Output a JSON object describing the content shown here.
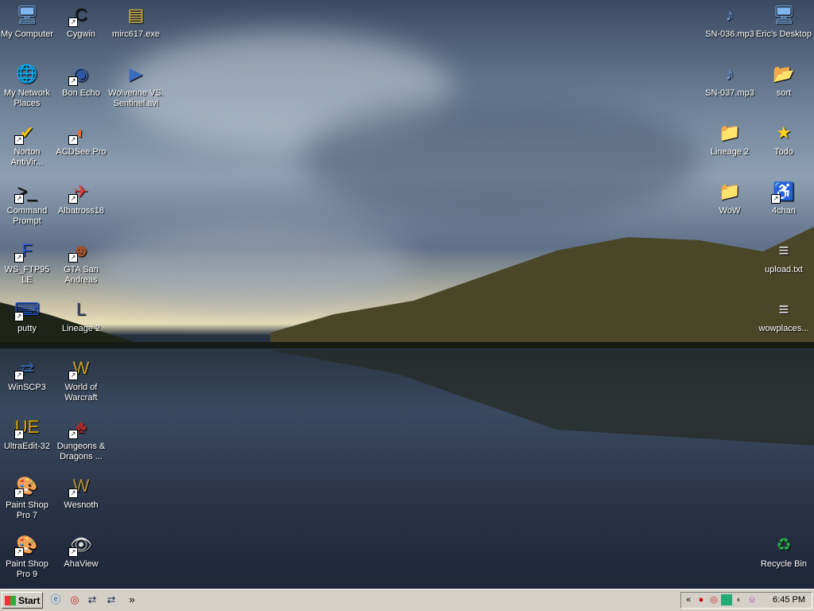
{
  "desktop": {
    "left_icons": [
      {
        "label": "My Computer",
        "icon": "my-computer-icon",
        "glyph": "🖥"
      },
      {
        "label": "Cygwin",
        "icon": "cygwin-icon",
        "glyph": "C"
      },
      {
        "label": "mirc617.exe",
        "icon": "installer-icon",
        "glyph": "▤"
      },
      {
        "label": "My Network Places",
        "icon": "network-icon",
        "glyph": "🌐"
      },
      {
        "label": "Bon Echo",
        "icon": "firefox-icon",
        "glyph": "◉"
      },
      {
        "label": "Wolverine VS. Sentinel.avi",
        "icon": "video-file-icon",
        "glyph": "▶"
      },
      {
        "label": "Norton AntiVir...",
        "icon": "norton-icon",
        "glyph": "✔"
      },
      {
        "label": "ACDSee Pro",
        "icon": "acdsee-icon",
        "glyph": "◐"
      },
      {
        "label": "Command Prompt",
        "icon": "cmd-icon",
        "glyph": ">_"
      },
      {
        "label": "Albatross18",
        "icon": "albatross-icon",
        "glyph": "✈"
      },
      {
        "label": "WS_FTP95 LE",
        "icon": "ftp-icon",
        "glyph": "F"
      },
      {
        "label": "GTA San Andreas",
        "icon": "gta-icon",
        "glyph": "☻"
      },
      {
        "label": "putty",
        "icon": "putty-icon",
        "glyph": "⌨"
      },
      {
        "label": "Lineage 2",
        "icon": "lineage-icon",
        "glyph": "L"
      },
      {
        "label": "WinSCP3",
        "icon": "winscp-icon",
        "glyph": "⇄"
      },
      {
        "label": "World of Warcraft",
        "icon": "wow-icon",
        "glyph": "W"
      },
      {
        "label": "UltraEdit-32",
        "icon": "ultraedit-icon",
        "glyph": "UE"
      },
      {
        "label": "Dungeons & Dragons ...",
        "icon": "dnd-icon",
        "glyph": "♣"
      },
      {
        "label": "Paint Shop Pro 7",
        "icon": "paintshop-icon",
        "glyph": "🎨"
      },
      {
        "label": "Wesnoth",
        "icon": "wesnoth-icon",
        "glyph": "W"
      },
      {
        "label": "Paint Shop Pro 9",
        "icon": "paintshop-icon",
        "glyph": "🎨"
      },
      {
        "label": "AhaView",
        "icon": "eye-icon",
        "glyph": "👁"
      }
    ],
    "right_icons": [
      {
        "label": "SN-036.mp3",
        "icon": "mp3-file-icon",
        "glyph": "♪"
      },
      {
        "label": "Eric's Desktop",
        "icon": "computer-icon",
        "glyph": "🖥"
      },
      {
        "label": "SN-037.mp3",
        "icon": "mp3-file-icon",
        "glyph": "♪"
      },
      {
        "label": "sort",
        "icon": "folder-open-icon",
        "glyph": "📂"
      },
      {
        "label": "Lineage 2",
        "icon": "folder-icon",
        "glyph": "📁"
      },
      {
        "label": "Todo",
        "icon": "star-icon",
        "glyph": "★"
      },
      {
        "label": "WoW",
        "icon": "folder-icon",
        "glyph": "📁"
      },
      {
        "label": "4chan",
        "icon": "accessibility-icon",
        "glyph": "♿"
      },
      {
        "label": "upload.txt",
        "icon": "text-file-icon",
        "glyph": "≡"
      },
      {
        "label": "wowplaces...",
        "icon": "text-file-icon",
        "glyph": "≡"
      },
      {
        "label": "Recycle Bin",
        "icon": "recycle-bin-icon",
        "glyph": "♻"
      }
    ]
  },
  "taskbar": {
    "start_label": "Start",
    "quick_launch": [
      "ie-icon",
      "antivirus-icon",
      "network-icon",
      "network-icon"
    ],
    "more": "»",
    "tray_chevron": "«",
    "clock": "6:45 PM"
  },
  "colors": {
    "taskbar": "#d4d0c8",
    "text": "#ffffff"
  }
}
